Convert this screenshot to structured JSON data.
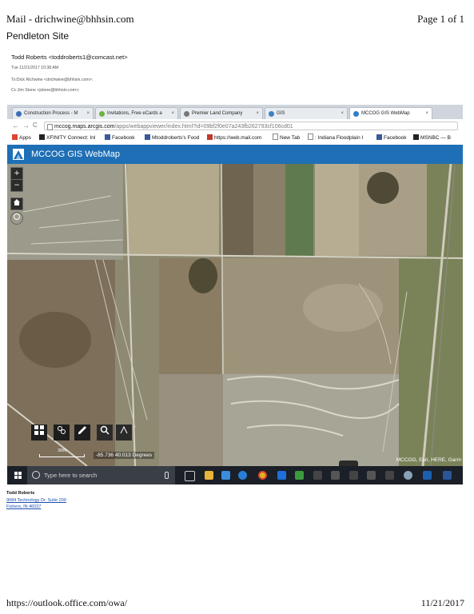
{
  "print_header": {
    "title": "Mail - drichwine@bhhsin.com",
    "page": "Page 1 of 1"
  },
  "email": {
    "subject": "Pendleton Site",
    "from": "Todd Roberts <toddroberts1@comcast.net>",
    "date": "Tue 11/21/2017 10:38 AM",
    "to_prefix": "To:",
    "to": "Dick Richwine <drichwine@bhhsin.com>;",
    "cc_prefix": "Cc:",
    "cc": "Jim Stone <jstone@bhhsin.com>;"
  },
  "browser": {
    "tabs": [
      {
        "label": "Construction Process - M",
        "color": "#3b6fb6"
      },
      {
        "label": "Invitations, Free eCards a",
        "color": "#6fb23b"
      },
      {
        "label": "Premier Land Company",
        "color": "#777777"
      },
      {
        "label": "GIS",
        "color": "#3b82c4"
      },
      {
        "label": "MCCOG GIS WebMap",
        "color": "#2a7fc7"
      }
    ],
    "tab_close": "×",
    "back": "←",
    "forward": "→",
    "reload": "C",
    "url_host": "mccog.maps.arcgis.com",
    "url_path": "/apps/webappviewer/index.html?id=09bf2f0e07a243fb262793cf106cd01",
    "bookmarks": [
      {
        "label": "Apps",
        "color": "#e0442e"
      },
      {
        "label": "XFINITY Connect: Inl",
        "color": "#222222"
      },
      {
        "label": "Facebook",
        "color": "#3b5998"
      },
      {
        "label": "Mtoddroberts's Food",
        "color": "#3b5998"
      },
      {
        "label": "https://web.mail.com",
        "color": "#c0392b"
      },
      {
        "label": "New Tab",
        "color": "#888888"
      },
      {
        "label": ": Indiana Floodplain I",
        "color": "#444444"
      },
      {
        "label": "Facebook",
        "color": "#3b5998"
      },
      {
        "label": "MSNBC — B",
        "color": "#222222"
      }
    ]
  },
  "app": {
    "title": "MCCOG GIS WebMap"
  },
  "map": {
    "zoom_in": "+",
    "zoom_out": "−",
    "coordinates": "-85.736 40.013 Degrees",
    "scale": "300ft",
    "attribution": "MCCOG, Esri, HERE, Garm"
  },
  "taskbar": {
    "search_placeholder": "Type here to search"
  },
  "signature": {
    "name": "Todd Roberts",
    "address1": "9084 Technology Dr. Suite 200",
    "address2": "Fishers, IN 46037"
  },
  "print_footer": {
    "url": "https://outlook.office.com/owa/",
    "date": "11/21/2017"
  }
}
